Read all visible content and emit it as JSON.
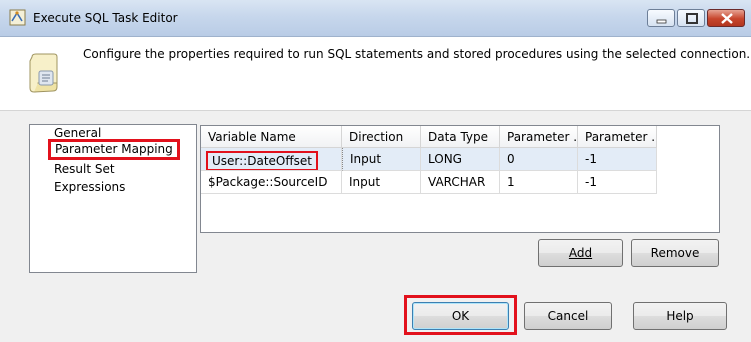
{
  "window": {
    "title": "Execute SQL Task Editor",
    "controls": {
      "minimize_icon": "minimize-icon",
      "maximize_icon": "maximize-icon",
      "close_icon": "close-icon"
    }
  },
  "header": {
    "icon": "sql-scroll-icon",
    "description": "Configure the properties required to run SQL statements and stored procedures using the selected connection."
  },
  "nav": {
    "items": [
      {
        "label": "General",
        "selected": false
      },
      {
        "label": "Parameter Mapping",
        "selected": true
      },
      {
        "label": "Result Set",
        "selected": false
      },
      {
        "label": "Expressions",
        "selected": false
      }
    ]
  },
  "grid": {
    "columns": [
      "Variable Name",
      "Direction",
      "Data Type",
      "Parameter ...",
      "Parameter ..."
    ],
    "rows": [
      [
        "User::DateOffset",
        "Input",
        "LONG",
        "0",
        "-1"
      ],
      [
        "$Package::SourceID",
        "Input",
        "VARCHAR",
        "1",
        "-1"
      ]
    ],
    "selected_row": 0
  },
  "grid_buttons": {
    "add": "Add",
    "remove": "Remove"
  },
  "footer": {
    "ok": "OK",
    "cancel": "Cancel",
    "help": "Help"
  },
  "colors": {
    "highlight": "#e2111c",
    "selected_row": "#e3ecf7"
  }
}
